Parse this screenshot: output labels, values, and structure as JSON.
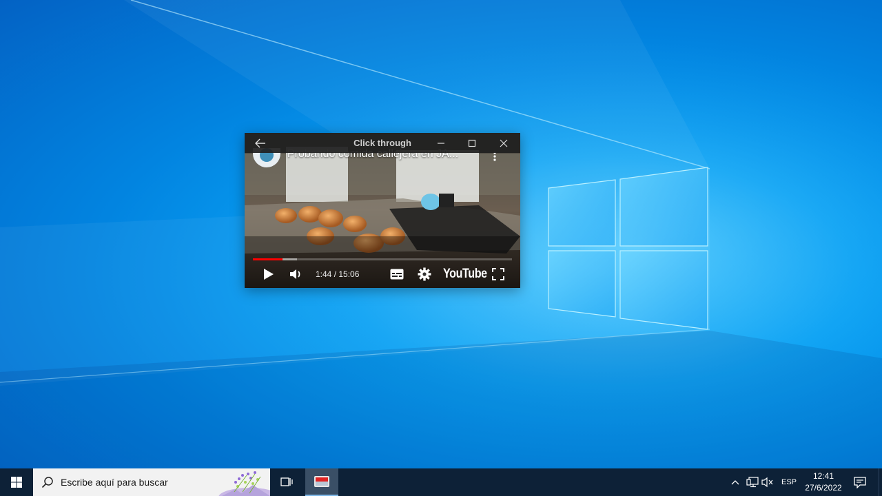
{
  "desktop": {
    "wallpaper": "windows-10-hero",
    "accent": "#0a8fe8"
  },
  "pip_window": {
    "title": "Click through",
    "back_icon": "arrow-left-icon",
    "minimize_icon": "minimize-icon",
    "maximize_icon": "maximize-icon",
    "close_icon": "close-icon"
  },
  "video": {
    "title": "Probando comida callejera en JA...",
    "time": "1:44 / 15:06",
    "progress_fraction": 0.115,
    "buffered_fraction": 0.17,
    "brand": "YouTube",
    "progress_color": "#ff0000"
  },
  "taskbar": {
    "start_icon": "windows-logo-icon",
    "search_placeholder": "Escribe aquí para buscar",
    "task_view_icon": "task-view-icon",
    "language": "ESP",
    "clock_time": "12:41",
    "clock_date": "27/6/2022"
  }
}
